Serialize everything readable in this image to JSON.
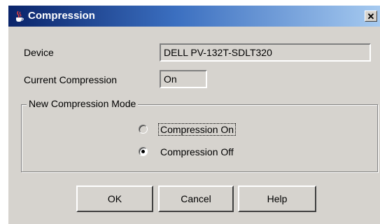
{
  "window": {
    "title": "Compression",
    "close_symbol": "✕"
  },
  "device": {
    "label": "Device",
    "value": "DELL PV-132T-SDLT320"
  },
  "current_compression": {
    "label": "Current Compression",
    "value": "On"
  },
  "mode_group": {
    "title": "New Compression Mode",
    "options": [
      {
        "label": "Compression On",
        "selected": false
      },
      {
        "label": "Compression Off",
        "selected": true
      }
    ]
  },
  "buttons": {
    "ok": "OK",
    "cancel": "Cancel",
    "help": "Help"
  }
}
